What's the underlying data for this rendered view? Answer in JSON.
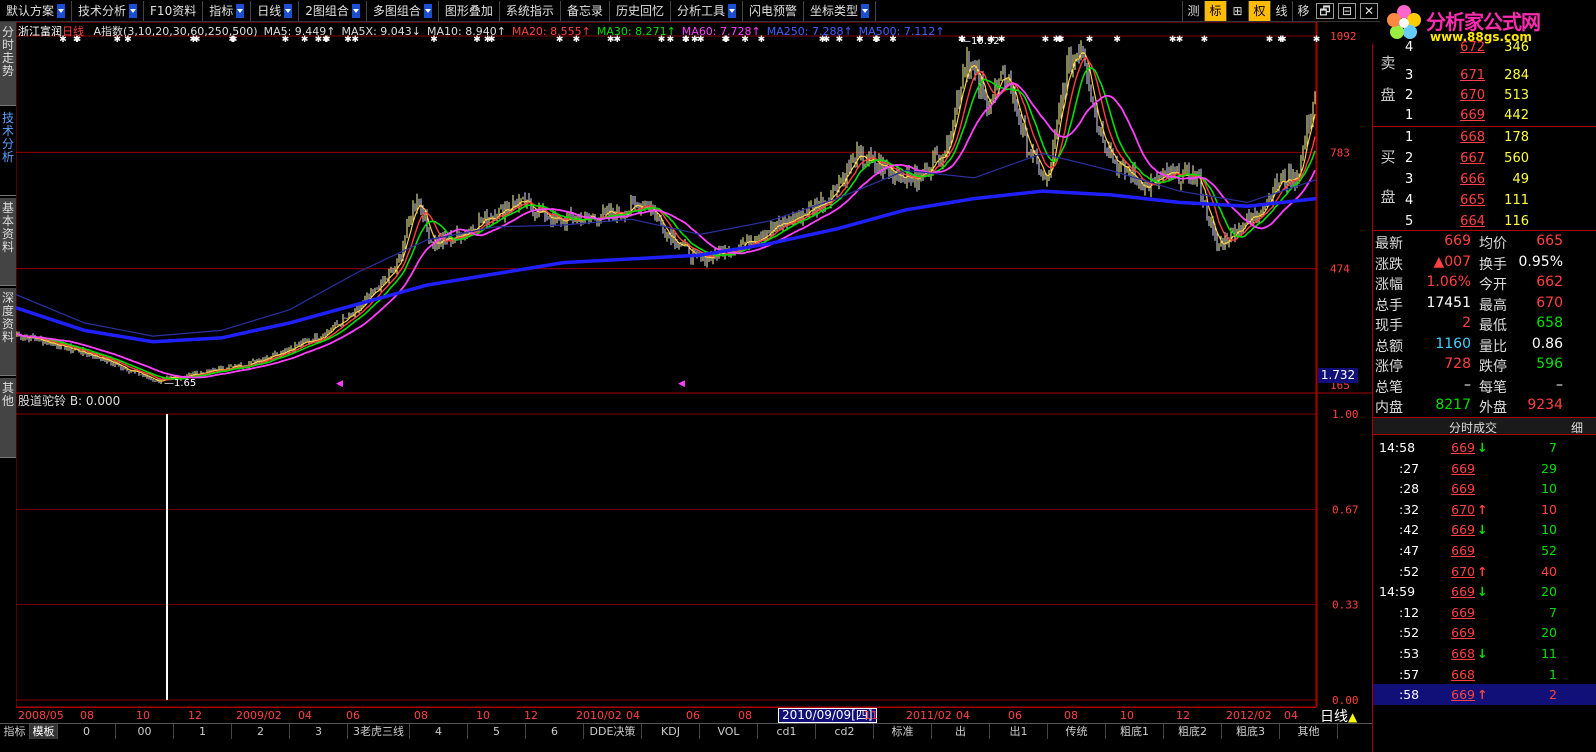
{
  "menu": {
    "items": [
      {
        "label": "默认方案",
        "arrow": true
      },
      {
        "label": "技术分析",
        "arrow": true
      },
      {
        "label": "F10资料",
        "arrow": false
      },
      {
        "label": "指标",
        "arrow": true
      },
      {
        "label": "日线",
        "arrow": true
      },
      {
        "label": "2图组合",
        "arrow": true
      },
      {
        "label": "多图组合",
        "arrow": true
      },
      {
        "label": "图形叠加",
        "arrow": false
      },
      {
        "label": "系统指示",
        "arrow": false
      },
      {
        "label": "备忘录",
        "arrow": false
      },
      {
        "label": "历史回忆",
        "arrow": false
      },
      {
        "label": "分析工具",
        "arrow": true
      },
      {
        "label": "闪电预警",
        "arrow": false
      },
      {
        "label": "坐标类型",
        "arrow": true
      }
    ],
    "tools": [
      "测",
      "标",
      "⊞",
      "权",
      "线",
      "移"
    ],
    "window_controls": [
      "🗗",
      "⊟",
      "✕"
    ]
  },
  "logo": {
    "brand": "分析家公式网",
    "url": "www.88gs.com"
  },
  "left_tabs": [
    "分时走势",
    "技术分析",
    "基本资料",
    "深度资料",
    "其他"
  ],
  "legend": {
    "stock_name": "浙江富润",
    "period": "日线",
    "items": [
      {
        "text": "A指数(3,10,20,30,60,250,500)",
        "color": "#dddddd"
      },
      {
        "text": "MA5: 9.449↑",
        "color": "#dddddd"
      },
      {
        "text": "MA5X: 9.043↓",
        "color": "#dddddd"
      },
      {
        "text": "MA10: 8.940↑",
        "color": "#dddddd"
      },
      {
        "text": "MA20: 8.555↑",
        "color": "#ff4040"
      },
      {
        "text": "MA30: 8.271↑",
        "color": "#00e000"
      },
      {
        "text": "MA60: 7.728↑",
        "color": "#ff40ff"
      },
      {
        "text": "MA250: 7.288↑",
        "color": "#4060ff"
      },
      {
        "text": "MA500: 7.112↑",
        "color": "#4060ff"
      }
    ]
  },
  "price_axis": {
    "labels": [
      "1092",
      "783",
      "474",
      "165"
    ]
  },
  "price_annotations": {
    "high": "10.92",
    "low": "1.65",
    "current": "1.732"
  },
  "indicator": {
    "title": "股道驼铃 B: 0.000",
    "axis": [
      "1.00",
      "0.67",
      "0.33",
      "0.00"
    ]
  },
  "date_axis": {
    "labels": [
      "2008/05",
      "08",
      "10",
      "12",
      "2009/02",
      "04",
      "06",
      "08",
      "10",
      "12",
      "2010/02",
      "04",
      "06",
      "08",
      "11",
      "2011/02",
      "04",
      "06",
      "08",
      "10",
      "12",
      "2012/02",
      "04"
    ],
    "selected": "2010/09/09[四]",
    "period": "日线"
  },
  "bottom_tabs": [
    "指标",
    "模板",
    "0",
    "00",
    "1",
    "2",
    "3",
    "3老虎三线",
    "4",
    "5",
    "6",
    "DDE决策",
    "KDJ",
    "VOL",
    "cd1",
    "cd2",
    "标准",
    "出",
    "出1",
    "传统",
    "粗底1",
    "粗底2",
    "粗底3",
    "其他"
  ],
  "right_bottom_tabs": [
    "细",
    "财",
    "价",
    "指",
    "势",
    "闻",
    "成",
    "评",
    "短"
  ],
  "order_book": {
    "sell": [
      {
        "label": "4",
        "price": "672",
        "vol": "346"
      },
      {
        "label": "3",
        "price": "671",
        "vol": "284"
      },
      {
        "label": "2",
        "price": "670",
        "vol": "513"
      },
      {
        "label": "1",
        "price": "669",
        "vol": "442"
      }
    ],
    "buy": [
      {
        "label": "1",
        "price": "668",
        "vol": "178"
      },
      {
        "label": "2",
        "price": "667",
        "vol": "560"
      },
      {
        "label": "3",
        "price": "666",
        "vol": "49"
      },
      {
        "label": "4",
        "price": "665",
        "vol": "111"
      },
      {
        "label": "5",
        "price": "664",
        "vol": "116"
      }
    ],
    "sell_side_label": [
      "卖",
      "盘"
    ],
    "buy_side_label": [
      "买",
      "盘"
    ]
  },
  "stats": [
    {
      "l1": "最新",
      "v1": "669",
      "c1": "red",
      "l2": "均价",
      "v2": "665",
      "c2": "red"
    },
    {
      "l1": "涨跌",
      "v1": "▲007",
      "c1": "red",
      "l2": "换手",
      "v2": "0.95%",
      "c2": "white"
    },
    {
      "l1": "涨幅",
      "v1": "1.06%",
      "c1": "red",
      "l2": "今开",
      "v2": "662",
      "c2": "red"
    },
    {
      "l1": "总手",
      "v1": "17451",
      "c1": "white",
      "l2": "最高",
      "v2": "670",
      "c2": "red"
    },
    {
      "l1": "现手",
      "v1": "2",
      "c1": "red",
      "l2": "最低",
      "v2": "658",
      "c2": "green"
    },
    {
      "l1": "总额",
      "v1": "1160",
      "c1": "cyan",
      "l2": "量比",
      "v2": "0.86",
      "c2": "white"
    },
    {
      "l1": "涨停",
      "v1": "728",
      "c1": "red",
      "l2": "跌停",
      "v2": "596",
      "c2": "green"
    },
    {
      "l1": "总笔",
      "v1": "–",
      "c1": "white",
      "l2": "每笔",
      "v2": "–",
      "c2": "white"
    },
    {
      "l1": "内盘",
      "v1": "8217",
      "c1": "green",
      "l2": "外盘",
      "v2": "9234",
      "c2": "red"
    }
  ],
  "ticks_header": {
    "title": "分时成交",
    "btn": "细"
  },
  "ticks": [
    {
      "time": "14:58",
      "price": "669",
      "dir": "down",
      "vol": "7",
      "vc": "green",
      "full": true
    },
    {
      "time": ":27",
      "price": "669",
      "dir": "",
      "vol": "29",
      "vc": "green",
      "full": false
    },
    {
      "time": ":28",
      "price": "669",
      "dir": "",
      "vol": "10",
      "vc": "green",
      "full": false
    },
    {
      "time": ":32",
      "price": "670",
      "dir": "up",
      "vol": "10",
      "vc": "red",
      "full": false
    },
    {
      "time": ":42",
      "price": "669",
      "dir": "down",
      "vol": "10",
      "vc": "green",
      "full": false
    },
    {
      "time": ":47",
      "price": "669",
      "dir": "",
      "vol": "52",
      "vc": "green",
      "full": false
    },
    {
      "time": ":52",
      "price": "670",
      "dir": "up",
      "vol": "40",
      "vc": "red",
      "full": false
    },
    {
      "time": "14:59",
      "price": "669",
      "dir": "down",
      "vol": "20",
      "vc": "green",
      "full": true
    },
    {
      "time": ":12",
      "price": "669",
      "dir": "",
      "vol": "7",
      "vc": "green",
      "full": false
    },
    {
      "time": ":52",
      "price": "669",
      "dir": "",
      "vol": "20",
      "vc": "green",
      "full": false
    },
    {
      "time": ":53",
      "price": "668",
      "dir": "down",
      "vol": "11",
      "vc": "green",
      "full": false
    },
    {
      "time": ":57",
      "price": "668",
      "dir": "",
      "vol": "1",
      "vc": "green",
      "full": false
    },
    {
      "time": ":58",
      "price": "669",
      "dir": "up",
      "vol": "2",
      "vc": "red",
      "full": false,
      "selected": true
    }
  ],
  "colors": {
    "up": "#ff4040",
    "down": "#00e000",
    "grid": "#aa0000",
    "ma5": "#ffffa0",
    "ma10": "#ffd040",
    "ma20": "#ff4040",
    "ma30": "#00e000",
    "ma60": "#ff40ff",
    "ma250": "#3040ff",
    "ma500": "#2020ff"
  },
  "chart_data": {
    "type": "line",
    "title": "浙江富润 日线",
    "ylim": [
      1.65,
      10.92
    ],
    "series": [
      {
        "name": "MA60",
        "values": [
          3.2,
          2.3,
          1.9,
          2.1,
          2.8,
          4.3,
          5.5,
          5.9,
          5.7,
          5.9,
          5.0,
          5.4,
          6.2,
          7.2,
          6.5,
          7.6,
          6.8,
          5.9,
          5.4,
          6.4
        ]
      },
      {
        "name": "MA250",
        "values": [
          3.7,
          3.1,
          2.8,
          2.9,
          3.3,
          3.8,
          4.3,
          4.6,
          4.9,
          5.0,
          5.1,
          5.4,
          5.8,
          6.3,
          6.6,
          6.8,
          6.7,
          6.5,
          6.4,
          6.6
        ]
      }
    ]
  }
}
